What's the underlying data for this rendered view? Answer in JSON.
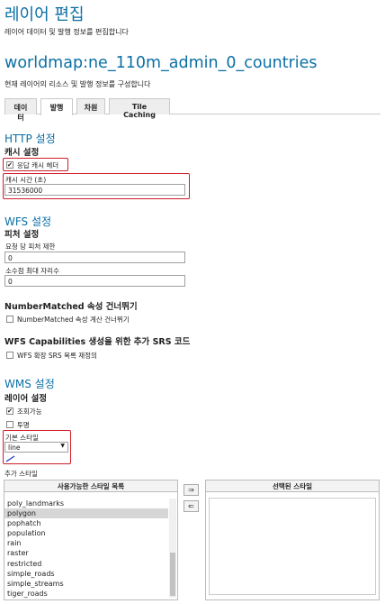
{
  "header": {
    "title": "레이어 편집",
    "description": "레이어 데이터 및 발행 정보를 편집합니다"
  },
  "layer": {
    "name": "worldmap:ne_110m_admin_0_countries",
    "description": "현재 레이어의 리소스 및 발행 정보를 구성합니다"
  },
  "tabs": [
    {
      "label": "데이터",
      "active": false
    },
    {
      "label": "발행",
      "active": true
    },
    {
      "label": "차원",
      "active": false
    },
    {
      "label": "Tile Caching",
      "active": false
    }
  ],
  "http": {
    "section_title": "HTTP 설정",
    "cache_title": "캐시 설정",
    "response_cache_label": "응답 캐시 헤더",
    "response_cache_checked": true,
    "cache_time_label": "캐시 시간 (초)",
    "cache_time_value": "31536000"
  },
  "wfs": {
    "section_title": "WFS 설정",
    "feature_title": "피처 설정",
    "max_features_label": "요청 당 피처 제한",
    "max_features_value": "0",
    "max_decimals_label": "소수점 최대 자리수",
    "max_decimals_value": "0",
    "nm_title": "NumberMatched 속성 건너뛰기",
    "nm_checkbox_label": "NumberMatched 속성 계산 건너뛰기",
    "nm_checked": false,
    "srs_title": "WFS Capabilities 생성을 위한 추가 SRS 코드",
    "srs_checkbox_label": "WFS 확장 SRS 목록 재정의",
    "srs_checked": false
  },
  "wms": {
    "section_title": "WMS 설정",
    "layer_title": "레이어 설정",
    "queryable_label": "조회가능",
    "queryable_checked": true,
    "opaque_label": "투명",
    "opaque_checked": false,
    "default_style_label": "기본 스타일",
    "default_style_value": "line",
    "extra_styles_label": "추가 스타일",
    "available_header": "사용가능한 스타일 목록",
    "selected_header": "선택된 스타일",
    "move_right": "⇒",
    "move_left": "⇐",
    "available_styles": [
      {
        "name": "poly_landmarks",
        "selected": false
      },
      {
        "name": "polygon",
        "selected": true
      },
      {
        "name": "pophatch",
        "selected": false
      },
      {
        "name": "population",
        "selected": false
      },
      {
        "name": "rain",
        "selected": false
      },
      {
        "name": "raster",
        "selected": false
      },
      {
        "name": "restricted",
        "selected": false
      },
      {
        "name": "simple_roads",
        "selected": false
      },
      {
        "name": "simple_streams",
        "selected": false
      },
      {
        "name": "tiger_roads",
        "selected": false
      }
    ]
  },
  "colors": {
    "accent": "#0b6fa4",
    "highlight_border": "#d11d2a",
    "selected_row": "#d6d6d6"
  }
}
